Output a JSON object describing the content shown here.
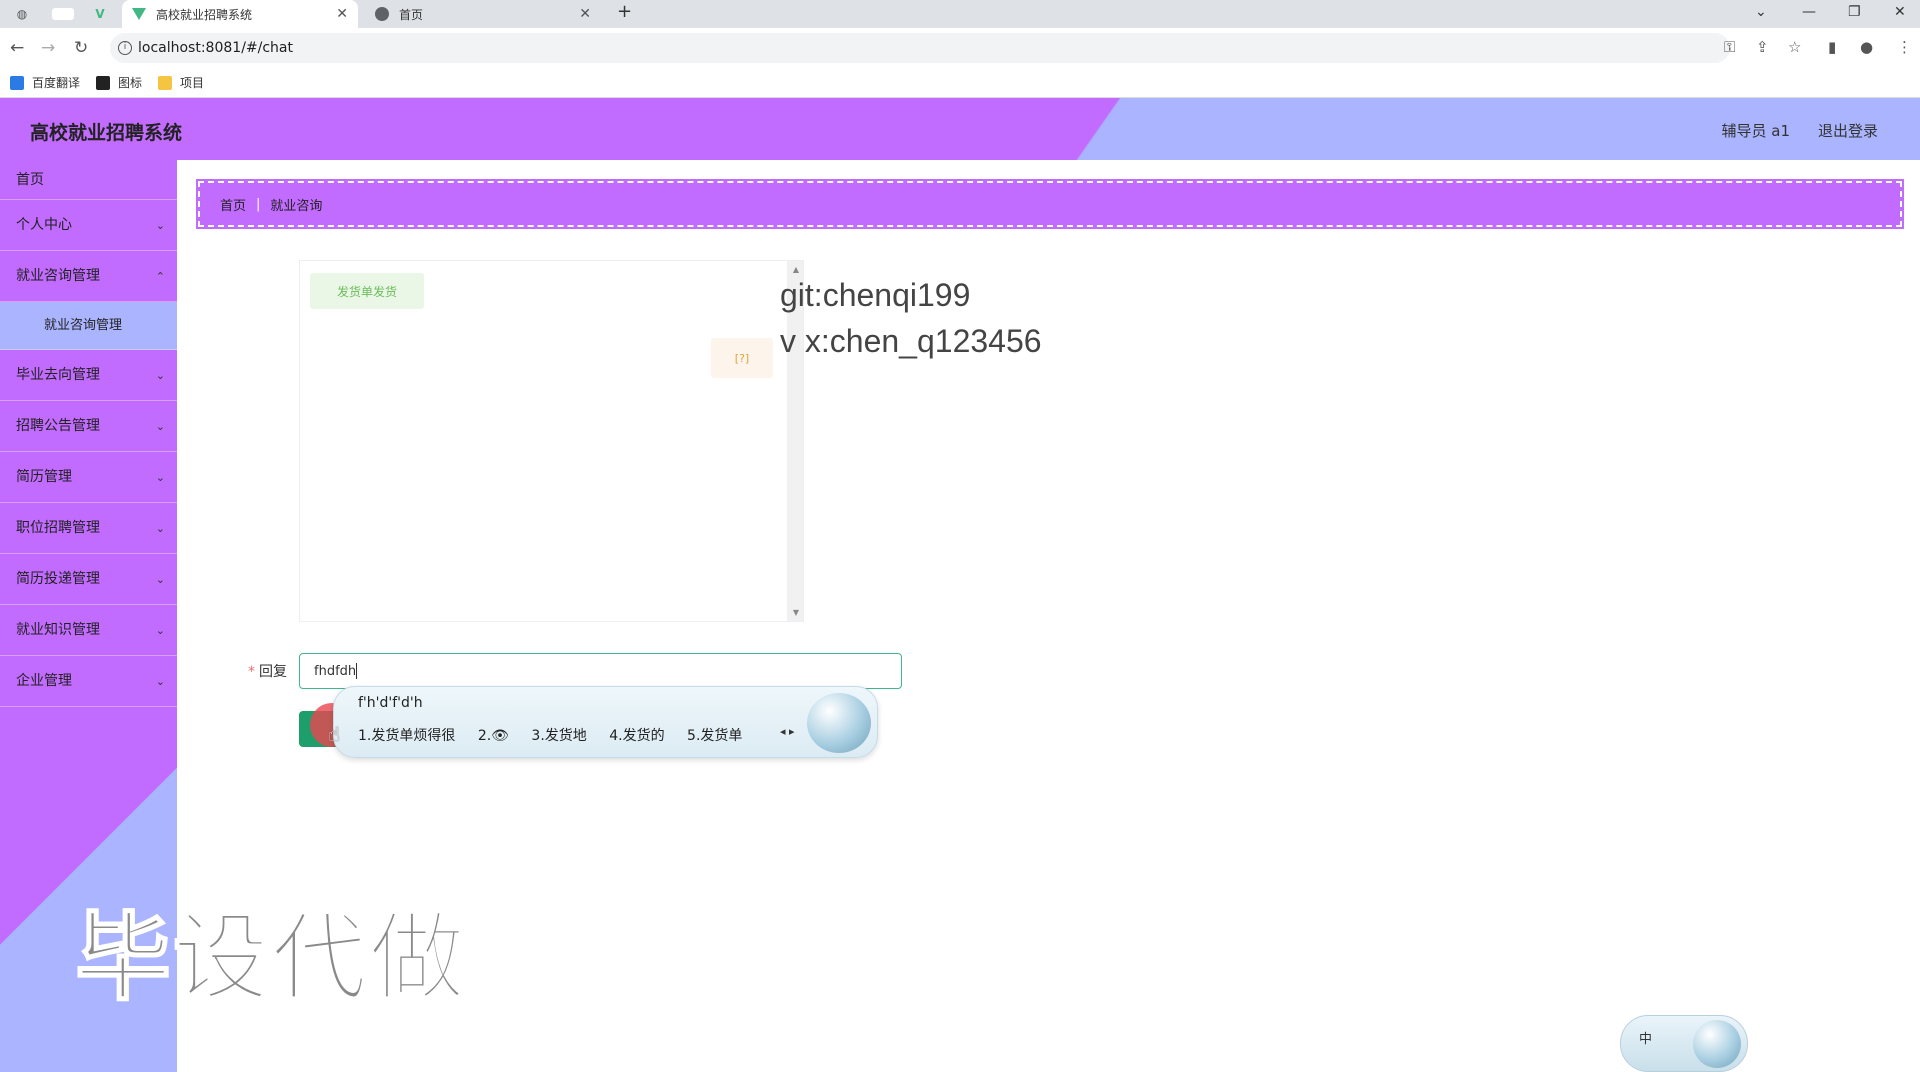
{
  "browser": {
    "tabs": [
      {
        "title": "高校就业招聘系统",
        "active": true
      },
      {
        "title": "首页",
        "active": false
      }
    ],
    "url": "localhost:8081/#/chat",
    "bookmarks": [
      "百度翻译",
      "图标",
      "项目"
    ],
    "new_tab": "+"
  },
  "header": {
    "title": "高校就业招聘系统",
    "user": "辅导员 a1",
    "logout": "退出登录"
  },
  "sidebar": {
    "items": [
      {
        "label": "首页",
        "chevron": false
      },
      {
        "label": "个人中心",
        "chevron": true
      },
      {
        "label": "就业咨询管理",
        "chevron": true
      },
      {
        "label": "就业咨询管理",
        "sub": true
      },
      {
        "label": "毕业去向管理",
        "chevron": true
      },
      {
        "label": "招聘公告管理",
        "chevron": true
      },
      {
        "label": "简历管理",
        "chevron": true
      },
      {
        "label": "职位招聘管理",
        "chevron": true
      },
      {
        "label": "简历投递管理",
        "chevron": true
      },
      {
        "label": "就业知识管理",
        "chevron": true
      },
      {
        "label": "企业管理",
        "chevron": true
      }
    ]
  },
  "breadcrumb": {
    "home": "首页",
    "current": "就业咨询"
  },
  "chat": {
    "messages": [
      {
        "side": "left",
        "text": "发货单发货"
      },
      {
        "side": "right",
        "text": "[?]"
      }
    ]
  },
  "overlay_text": {
    "line1": "git:chenqi199",
    "line2": "v x:chen_q123456"
  },
  "reply": {
    "label": "回复",
    "value": "fhdfdh"
  },
  "ime": {
    "composition": "f'h'd'f'd'h",
    "candidates": [
      "1.发货单烦得很",
      "2.👁",
      "3.发货地",
      "4.发货的",
      "5.发货单"
    ],
    "tray_label": "中"
  },
  "watermark": "毕设代做",
  "colors": {
    "purple": "#c26bff",
    "lavender": "#aab4ff",
    "accent_green": "#1e9e6a"
  }
}
